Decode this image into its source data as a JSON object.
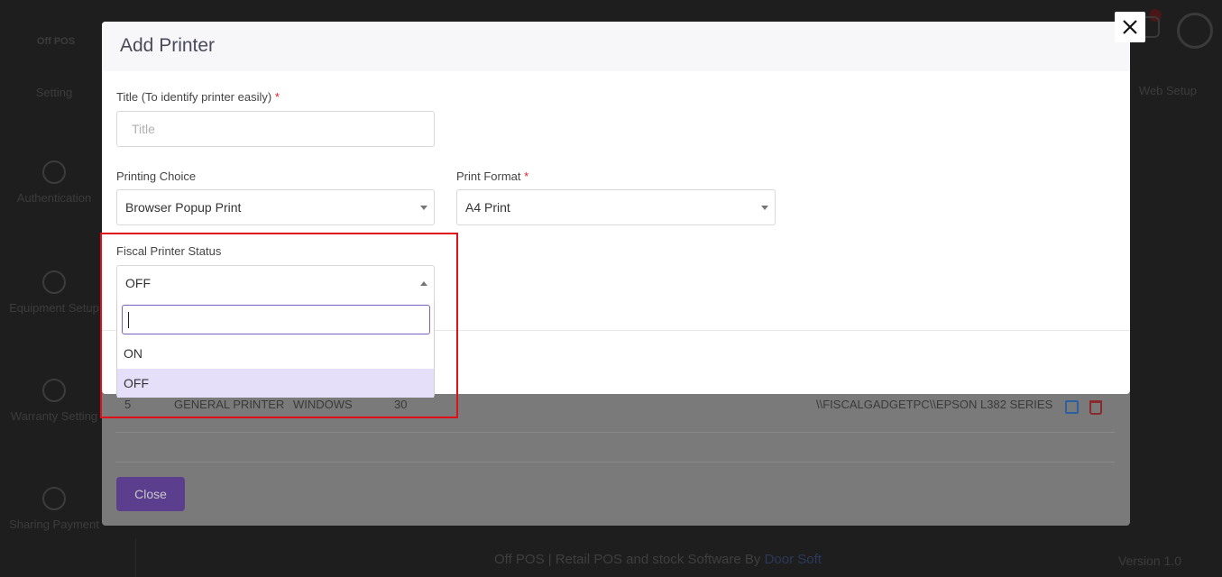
{
  "background": {
    "logo_text": "Off POS",
    "sidebar": [
      "Setting",
      "Authentication",
      "Equipment Setup",
      "Warranty Setting",
      "Sharing Payment"
    ],
    "right_label": "Web Setup",
    "footer": {
      "text": "Off POS | Retail POS and stock Software By ",
      "link": "Door Soft",
      "version": "Version 1.0"
    },
    "table_row": {
      "sn": "5",
      "title": "GENERAL PRINTER",
      "type": "WINDOWS",
      "chars": "30",
      "path": "\\\\FISCALGADGETPC\\\\EPSON L382 SERIES"
    },
    "close_button": "Close"
  },
  "modal": {
    "title": "Add Printer",
    "title_field": {
      "label": "Title (To identify printer easily)",
      "required_mark": "*",
      "placeholder": "Title"
    },
    "printing_choice": {
      "label": "Printing Choice",
      "value": "Browser Popup Print"
    },
    "print_format": {
      "label": "Print Format",
      "required_mark": "*",
      "value": "A4 Print"
    },
    "fiscal_status": {
      "label": "Fiscal Printer Status",
      "value": "OFF",
      "options": [
        "ON",
        "OFF"
      ],
      "selected_option": "OFF"
    }
  },
  "colors": {
    "accent": "#7a5fc0",
    "highlight_border": "#e0101a",
    "selected_option_bg": "#e6dffa",
    "required": "#e0202a"
  }
}
